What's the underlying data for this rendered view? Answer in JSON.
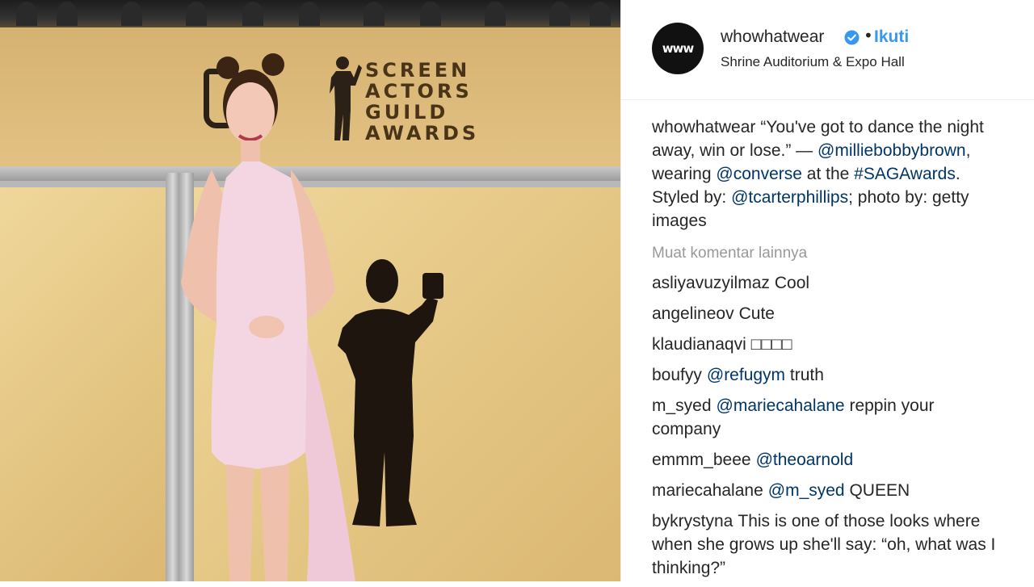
{
  "photo": {
    "backdrop_logo_lines": [
      "SCREEN",
      "ACTORS",
      "GUILD",
      "AWARDS"
    ]
  },
  "post": {
    "avatar_text": "www",
    "username": "whowhatwear",
    "dot": "•",
    "follow_label": "Ikuti",
    "location": "Shrine Auditorium & Expo Hall",
    "verified_color": "#3897f0",
    "follow_color": "#3897f0"
  },
  "caption": {
    "user": "whowhatwear",
    "text_1": "“You've got to dance the night away, win or lose.” —",
    "mention_1": "@milliebobbybrown",
    "text_2": ", wearing",
    "mention_2": "@converse",
    "text_3": "at the",
    "mention_3": "#SAGAwards",
    "text_4": ". Styled by:",
    "mention_4": "@tcarterphillips",
    "text_5": "; photo by: getty images"
  },
  "load_more": "Muat komentar lainnya",
  "comments": [
    {
      "user": "asliyavuzyilmaz",
      "mention": "",
      "text": "Cool"
    },
    {
      "user": "angelineov",
      "mention": "",
      "text": "Cute"
    },
    {
      "user": "klaudianaqvi",
      "mention": "",
      "text": "□□□□"
    },
    {
      "user": "boufyy",
      "mention": "@refugym",
      "text": "truth"
    },
    {
      "user": "m_syed",
      "mention": "@mariecahalane",
      "text": "reppin your company"
    },
    {
      "user": "emmm_beee",
      "mention": "@theoarnold",
      "text": ""
    },
    {
      "user": "mariecahalane",
      "mention": "@m_syed",
      "text": "QUEEN"
    },
    {
      "user": "bykrystyna",
      "mention": "",
      "text": "This is one of those looks where when she grows up she'll say: “oh, what was I thinking?”"
    }
  ]
}
